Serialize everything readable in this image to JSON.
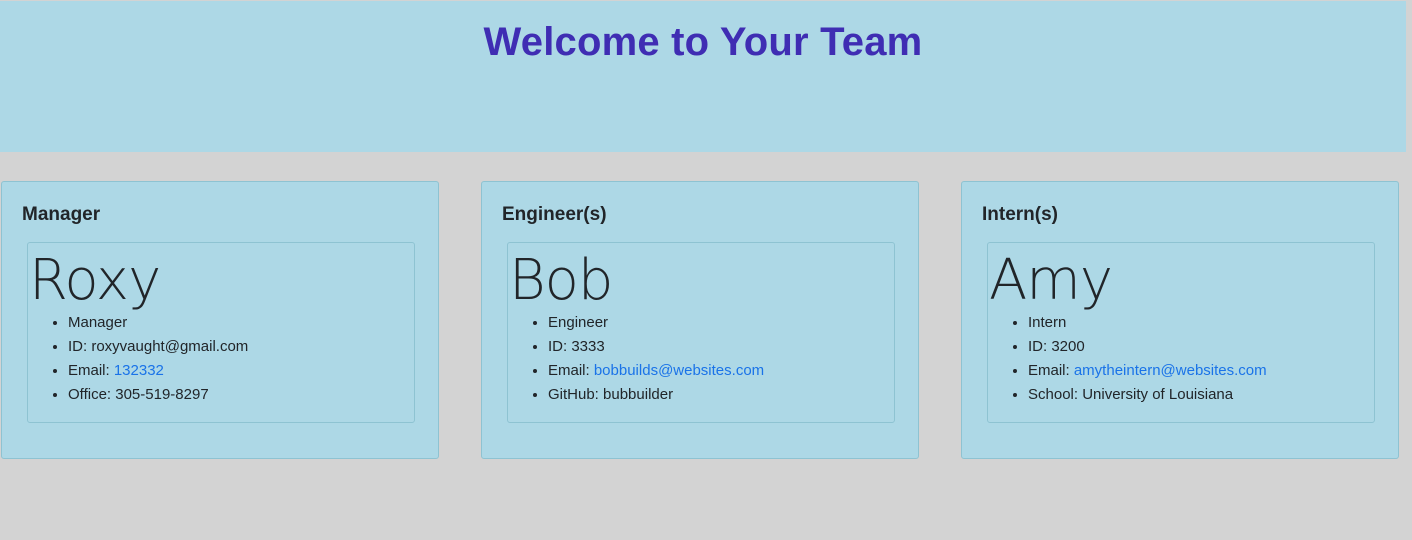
{
  "header": {
    "title": "Welcome to Your Team"
  },
  "manager": {
    "section_title": "Manager",
    "name": "Roxy",
    "role": "Manager",
    "id_label": "ID: ",
    "id": "roxyvaught@gmail.com",
    "email_label": "Email: ",
    "email": "132332",
    "extra_label": "Office: ",
    "extra": "305-519-8297"
  },
  "engineer": {
    "section_title": "Engineer(s)",
    "name": "Bob",
    "role": "Engineer",
    "id_label": "ID: ",
    "id": "3333",
    "email_label": "Email: ",
    "email": "bobbuilds@websites.com",
    "extra_label": "GitHub: ",
    "extra": "bubbuilder"
  },
  "intern": {
    "section_title": "Intern(s)",
    "name": "Amy",
    "role": "Intern",
    "id_label": "ID: ",
    "id": "3200",
    "email_label": "Email: ",
    "email": "amytheintern@websites.com",
    "extra_label": "School: ",
    "extra": "University of Louisiana"
  },
  "colors": {
    "background": "#d3d3d3",
    "panel": "#add8e6",
    "title": "#3f2db3",
    "link": "#1a73e8"
  }
}
